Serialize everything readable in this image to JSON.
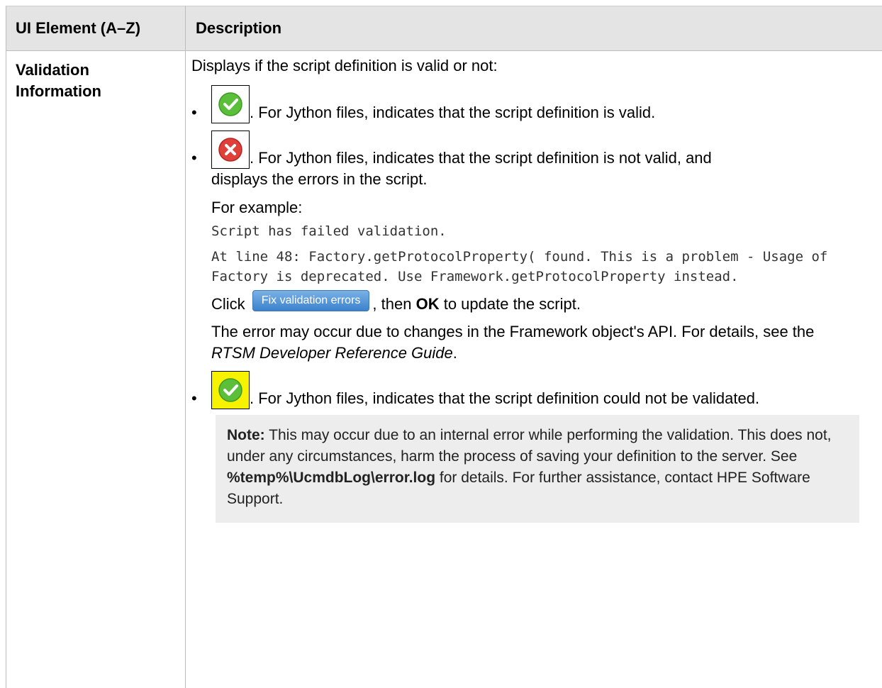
{
  "header": {
    "col1": "UI Element (A–Z)",
    "col2": "Description"
  },
  "row": {
    "element_name": "Validation Information",
    "intro": "Displays if the script definition is valid or not:",
    "items": [
      {
        "icon": "valid-check-icon",
        "text": ". For Jython files, indicates that the script definition is valid."
      },
      {
        "icon": "invalid-x-icon",
        "text": ". For Jython files, indicates that the script definition is not valid, and displays the errors in the script."
      },
      {
        "icon": "unvalidated-check-icon",
        "text": ". For Jython files, indicates that the script definition could not be validated."
      }
    ],
    "example_label": "For example:",
    "code_line1": "Script has failed validation.",
    "code_line2": "At line 48: Factory.getProtocolProperty( found. This is a problem - Usage of Factory is deprecated. Use Framework.getProtocolProperty instead.",
    "click_prefix": "Click",
    "fix_button_label": "Fix validation errors",
    "click_mid": ", then",
    "ok_label": "OK",
    "click_suffix": "to update the script.",
    "api_text": "The error may occur due to changes in the Framework object's API. For details, see the",
    "guide_title": "RTSM Developer Reference Guide",
    "api_end": ".",
    "note_label": "Note:",
    "note_text1": "This may occur due to an internal error while performing the validation. This does not, under any circumstances, harm the process of saving your definition to the server. See",
    "note_path": "%temp%\\UcmdbLog\\error.log",
    "note_text2": "for details. For further assistance, contact HPE Software Support."
  },
  "colors": {
    "header_bg": "#e4e4e4",
    "note_bg": "#ededed",
    "valid_green": "#5cbf3a",
    "error_red": "#e0403a",
    "warning_yellow": "#f7f300",
    "button_blue": "#3c82cc"
  }
}
